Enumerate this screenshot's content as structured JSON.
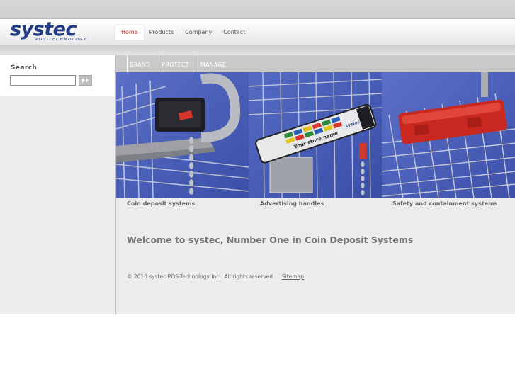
{
  "logo": {
    "word": "systec",
    "subtitle": "POS-TECHNOLOGY"
  },
  "nav": {
    "items": [
      "Home",
      "Products",
      "Company",
      "Contact"
    ],
    "active": "Home"
  },
  "search": {
    "label": "Search",
    "value": "",
    "placeholder": ""
  },
  "subnav": {
    "items": [
      "BRAND",
      "PROTECT",
      "MANAGE"
    ]
  },
  "tiles": [
    {
      "caption": "Coin deposit systems"
    },
    {
      "caption": "Advertising handles",
      "handle_text": "Your store name",
      "brand_text": "systec"
    },
    {
      "caption": "Safety and containment systems"
    }
  ],
  "welcome": "Welcome to systec, Number One in Coin Deposit Systems",
  "footer": {
    "copyright": "© 2010 systec POS-Technology Inc.. All rights reserved.",
    "sitemap": "Sitemap"
  },
  "colors": {
    "brand": "#203c83",
    "active_nav": "#c03020",
    "tile_bg": "#4a5fb4"
  }
}
